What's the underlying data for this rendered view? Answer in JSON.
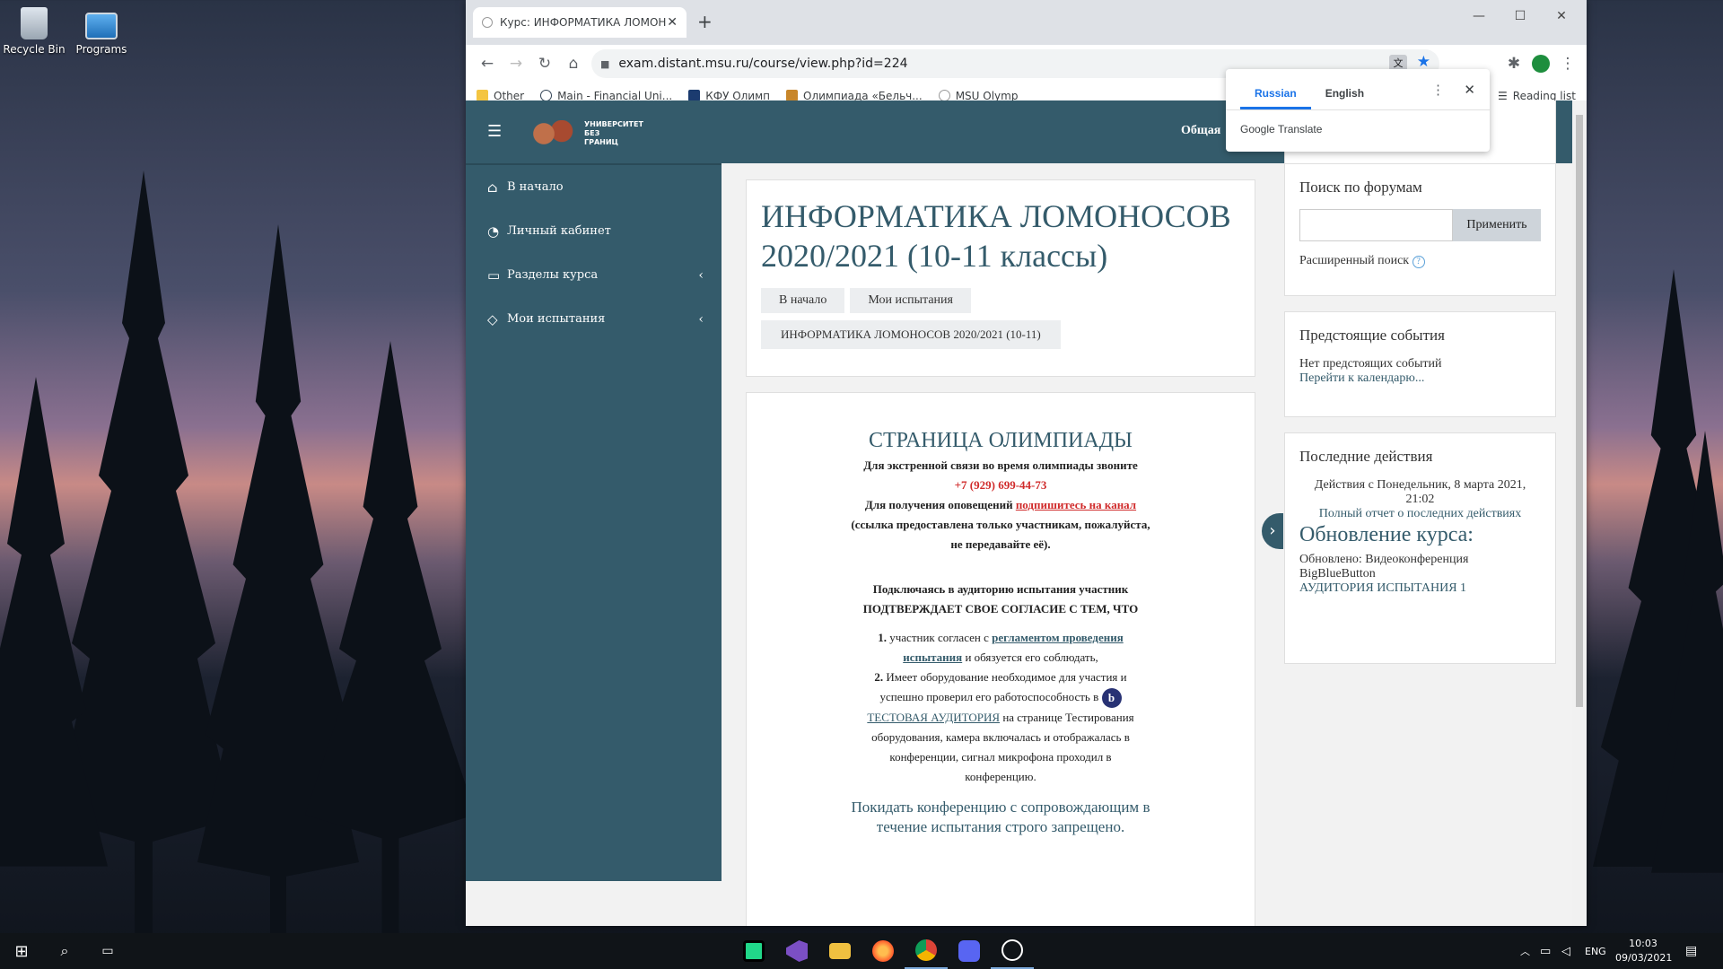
{
  "desktop": {
    "icons": [
      {
        "label": "Recycle Bin"
      },
      {
        "label": "Programs"
      }
    ]
  },
  "browser": {
    "tab_title": "Курс: ИНФОРМАТИКА ЛОМОНОСОВ",
    "url": "exam.distant.msu.ru/course/view.php?id=224",
    "reading_list": "Reading list",
    "bookmarks": [
      "Other",
      "Main - Financial Uni...",
      "КФУ Олимп",
      "Олимпиада «Бельч...",
      "MSU Olymp"
    ]
  },
  "translate_popup": {
    "lang_from": "Russian",
    "lang_to": "English",
    "brand": "Google Translate"
  },
  "site": {
    "logo_lines": [
      "УНИВЕРСИТЕТ",
      "БЕЗ",
      "ГРАНИЦ"
    ],
    "nav_partial": "Общая",
    "drawer": [
      "В начало",
      "Личный кабинет",
      "Разделы курса",
      "Мои испытания"
    ]
  },
  "course": {
    "title": "ИНФОРМАТИКА ЛОМОНОСОВ 2020/2021 (10-11 классы)",
    "breadcrumbs": [
      "В начало",
      "Мои испытания",
      "ИНФОРМАТИКА ЛОМОНОСОВ 2020/2021 (10-11)"
    ]
  },
  "content": {
    "heading": "СТРАНИЦА ОЛИМПИАДЫ",
    "emergency": "Для экстренной связи во время олимпиады звоните",
    "phone": "+7 (929) 699-44-73",
    "notify_prefix": "Для получения оповещений",
    "notify_link": "подпишитесь на канал",
    "notify_note": "(ссылка предоставлена только участникам, пожалуйста, не передавайте её).",
    "agree_1": "Подключаясь в аудиторию испытания участник",
    "agree_2": "ПОДТВЕРЖДАЕТ СВОЕ СОГЛАСИЕ С ТЕМ, ЧТО",
    "item1_num": "1.",
    "item1_pre": "участник согласен с",
    "item1_link": "регламентом проведения испытания",
    "item1_post": "и обязуется его соблюдать,",
    "item2_num": "2.",
    "item2_pre": "Имеет оборудование необходимое для участия и успешно проверил его работоспособность в",
    "item2_link": "ТЕСТОВАЯ АУДИТОРИЯ",
    "item2_post": "на странице Тестирования оборудования, камера включалась и отображалась в конференции, сигнал микрофона проходил в конференцию.",
    "warning": "Покидать конференцию с сопровождающим в течение испытания строго запрещено."
  },
  "right": {
    "search_title": "Поиск по форумам",
    "search_btn": "Применить",
    "adv_search": "Расширенный поиск",
    "events_title": "Предстоящие события",
    "events_none": "Нет предстоящих событий",
    "events_link": "Перейти к календарю...",
    "recent_title": "Последние действия",
    "recent_since": "Действия с Понедельник, 8 марта 2021, 21:02",
    "recent_full": "Полный отчет о последних действиях",
    "update_title": "Обновление курса:",
    "update_text": "Обновлено: Видеоконференция BigBlueButton",
    "update_link": "АУДИТОРИЯ ИСПЫТАНИЯ 1"
  },
  "taskbar": {
    "lang": "ENG",
    "time": "10:03",
    "date": "09/03/2021"
  }
}
